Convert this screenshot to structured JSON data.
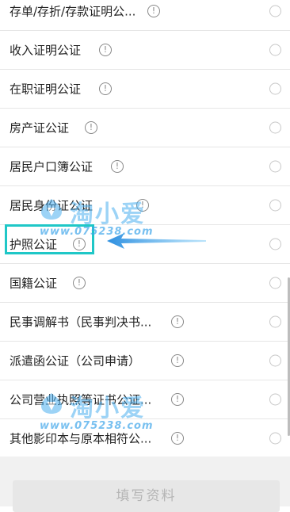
{
  "items": [
    {
      "label": "存单/存折/存款证明公...",
      "has_info": true
    },
    {
      "label": "收入证明公证",
      "has_info": true
    },
    {
      "label": "在职证明公证",
      "has_info": true
    },
    {
      "label": "房产证公证",
      "has_info": true
    },
    {
      "label": "居民户口簿公证",
      "has_info": true
    },
    {
      "label": "居民身份证公证",
      "has_info": true
    },
    {
      "label": "护照公证",
      "has_info": true
    },
    {
      "label": "国籍公证",
      "has_info": true
    },
    {
      "label": "民事调解书（民事判决书...",
      "has_info": true
    },
    {
      "label": "派遣函公证（公司申请）",
      "has_info": true
    },
    {
      "label": "公司营业执照等证书公证...",
      "has_info": true
    },
    {
      "label": "其他影印本与原本相符公...",
      "has_info": true
    }
  ],
  "info_glyph": "!",
  "submit_label": "填写资料",
  "watermark": {
    "title": "淘小爱",
    "url": "www.075238.com"
  },
  "colors": {
    "highlight": "#1fc7c7",
    "arrow": "#3a9ee8",
    "watermark": "#4db0f0"
  }
}
